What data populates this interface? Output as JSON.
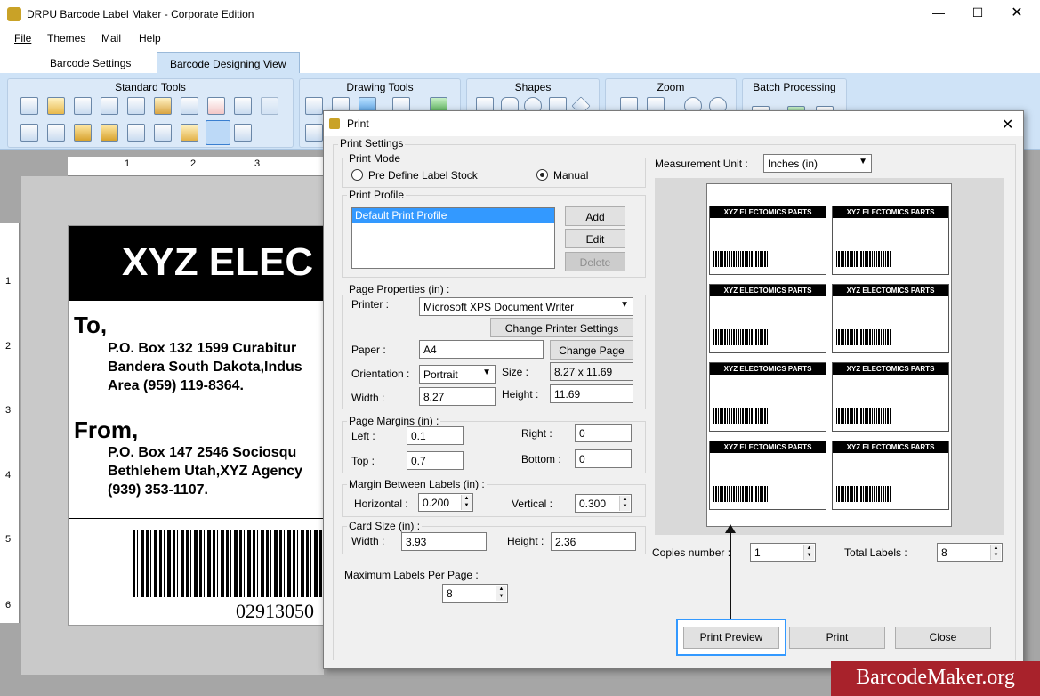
{
  "window": {
    "title": "DRPU Barcode Label Maker - Corporate Edition"
  },
  "menu": [
    "File",
    "Themes",
    "Mail",
    "Help"
  ],
  "tabs": [
    "Barcode Settings",
    "Barcode Designing View"
  ],
  "ribbon": {
    "groups": [
      "Standard Tools",
      "Drawing Tools",
      "Shapes",
      "Zoom",
      "Batch Processing"
    ]
  },
  "ruler": {
    "top": [
      "1",
      "2",
      "3"
    ],
    "left": [
      "1",
      "2",
      "3",
      "4",
      "5",
      "6"
    ]
  },
  "label": {
    "banner": "XYZ ELEC",
    "to": "To,",
    "to_lines": [
      "P.O. Box 132 1599 Curabitur",
      "Bandera South Dakota,Indus",
      "Area (959) 119-8364."
    ],
    "from": "From,",
    "from_lines": [
      "P.O. Box 147 2546 Sociosqu",
      "Bethlehem Utah,XYZ Agency",
      "(939) 353-1107."
    ],
    "barcode_number": "02913050"
  },
  "dialog": {
    "title": "Print",
    "print_settings": "Print Settings",
    "print_mode": {
      "legend": "Print Mode",
      "options": [
        "Pre Define Label Stock",
        "Manual"
      ],
      "selected": "Manual"
    },
    "print_profile": {
      "legend": "Print Profile",
      "items": [
        "Default Print Profile"
      ],
      "add": "Add",
      "edit": "Edit",
      "delete": "Delete"
    },
    "page_properties": {
      "legend": "Page Properties (in) :",
      "printer_label": "Printer :",
      "printer_value": "Microsoft XPS Document Writer",
      "change_printer": "Change Printer Settings",
      "paper_label": "Paper :",
      "paper_value": "A4",
      "change_page": "Change Page",
      "orientation_label": "Orientation :",
      "orientation_value": "Portrait",
      "size_label": "Size :",
      "size_value": "8.27 x 11.69",
      "width_label": "Width :",
      "width_value": "8.27",
      "height_label": "Height :",
      "height_value": "11.69"
    },
    "page_margins": {
      "legend": "Page Margins (in) :",
      "left_label": "Left :",
      "left_value": "0.1",
      "right_label": "Right :",
      "right_value": "0",
      "top_label": "Top :",
      "top_value": "0.7",
      "bottom_label": "Bottom :",
      "bottom_value": "0"
    },
    "margin_between": {
      "legend": "Margin Between Labels (in) :",
      "horizontal_label": "Horizontal :",
      "horizontal_value": "0.200",
      "vertical_label": "Vertical :",
      "vertical_value": "0.300"
    },
    "card_size": {
      "legend": "Card Size (in) :",
      "width_label": "Width :",
      "width_value": "3.93",
      "height_label": "Height :",
      "height_value": "2.36"
    },
    "max_labels": {
      "label": "Maximum Labels Per Page :",
      "value": "8"
    },
    "measurement": {
      "label": "Measurement Unit :",
      "value": "Inches (in)"
    },
    "preview_label_title": "XYZ ELECTOMICS  PARTS",
    "preview_label_count": 8,
    "copies": {
      "label": "Copies number :",
      "value": "1"
    },
    "total": {
      "label": "Total Labels :",
      "value": "8"
    },
    "buttons": {
      "preview": "Print Preview",
      "print": "Print",
      "close": "Close"
    }
  },
  "watermark": "BarcodeMaker.org",
  "colors": {
    "ribbon": "#cfe3f7",
    "highlight": "#3399ff",
    "watermark": "#a8222b"
  }
}
